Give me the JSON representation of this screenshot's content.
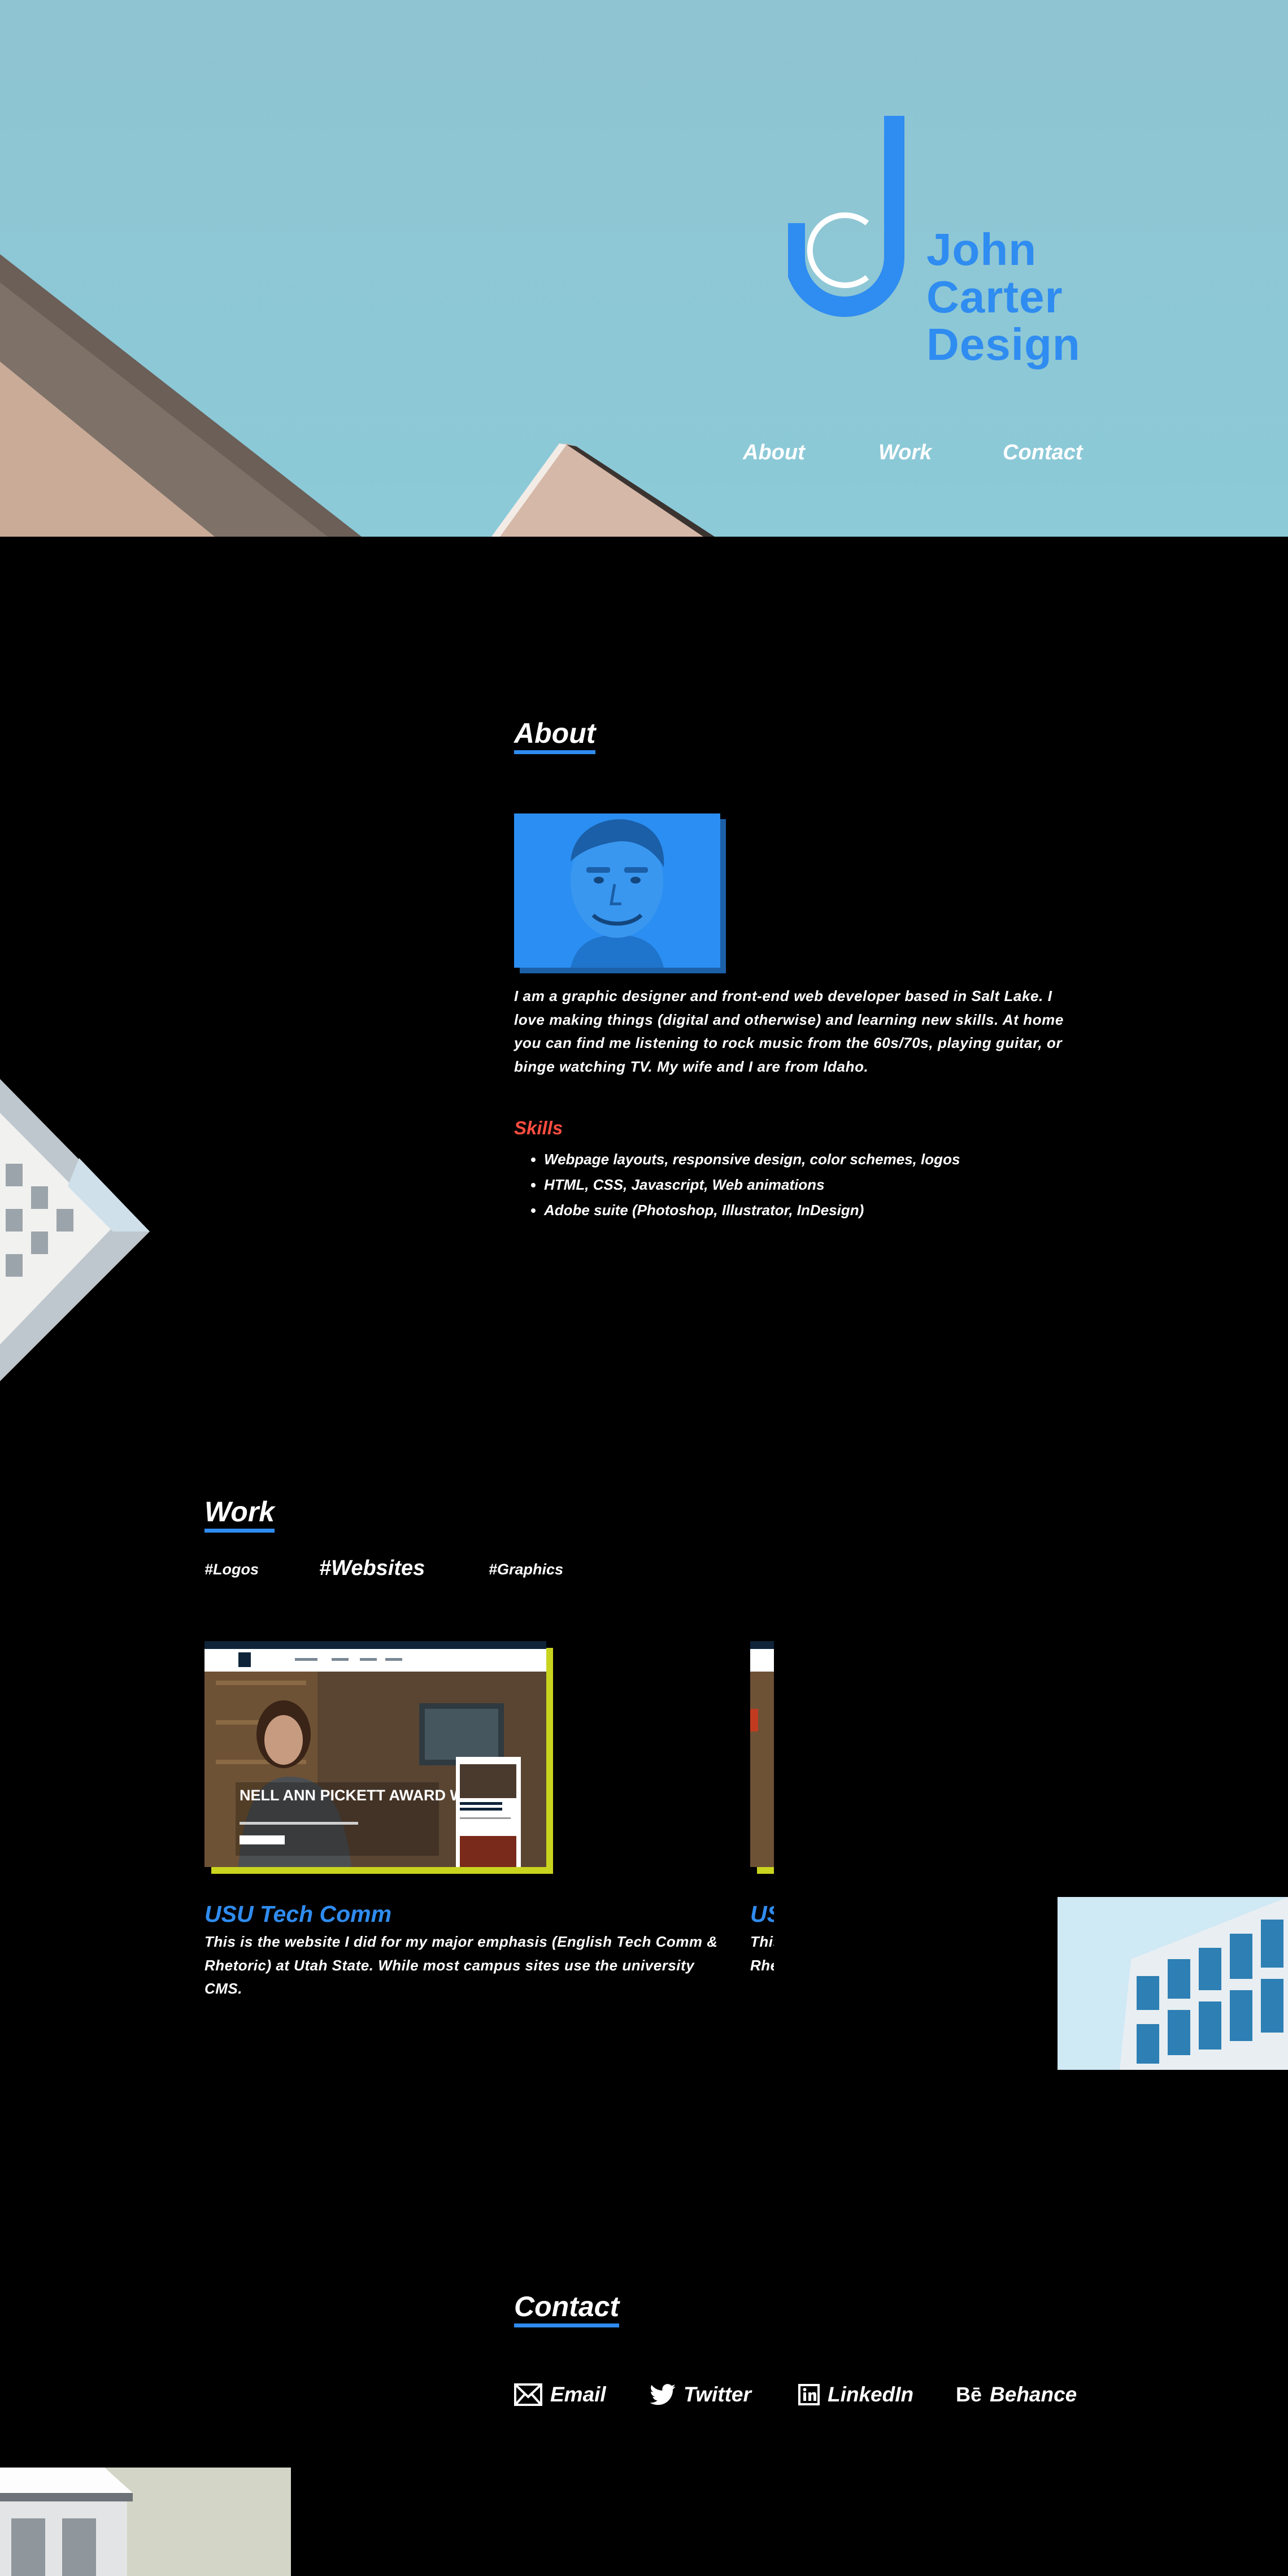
{
  "brand": {
    "logo_lines": [
      "John",
      "Carter",
      "Design"
    ],
    "color": "#2f8cf0"
  },
  "nav": {
    "items": [
      "About",
      "Work",
      "Contact"
    ]
  },
  "about": {
    "title": "About",
    "bio": "I am a graphic designer and front-end web developer based in Salt Lake. I love making things (digital and otherwise) and learning new skills. At home you can find me listening to rock music from the 60s/70s, playing guitar, or binge watching TV. My wife and I are from Idaho.",
    "skills_title": "Skills",
    "skills": [
      "Webpage layouts, responsive design, color schemes, logos",
      "HTML, CSS, Javascript, Web animations",
      "Adobe suite (Photoshop, Illustrator, InDesign)"
    ]
  },
  "work": {
    "title": "Work",
    "tags": [
      "#Logos",
      "#Websites",
      "#Graphics"
    ],
    "active_tag": "#Websites",
    "cards": [
      {
        "title": "USU Tech Comm",
        "description": "This is the website I did for my major emphasis (English Tech Comm & Rhetoric) at Utah State. While most campus sites use the university CMS.",
        "thumb_headline": "NELL ANN PICKETT AWARD WINNER",
        "thumb_mobile_headline": "NELL ANN PICKETT AWARD WINNER"
      },
      {
        "title": "USU Tech Comm",
        "description": "This is the website I did for my major emphasis (English Tech Comm & Rhetoric) at Utah State."
      }
    ]
  },
  "contact": {
    "title": "Contact",
    "links": [
      {
        "label": "Email",
        "icon": "envelope-icon"
      },
      {
        "label": "Twitter",
        "icon": "twitter-bird-icon"
      },
      {
        "label": "LinkedIn",
        "icon": "linkedin-icon"
      },
      {
        "label": "Behance",
        "icon": "behance-icon",
        "prefix": "Bē"
      }
    ]
  },
  "colors": {
    "accent": "#2f8cf0",
    "skills_red": "#ff4d40",
    "card_shadow": "#c9d41f",
    "hero_sky": "#8cc8d6"
  }
}
